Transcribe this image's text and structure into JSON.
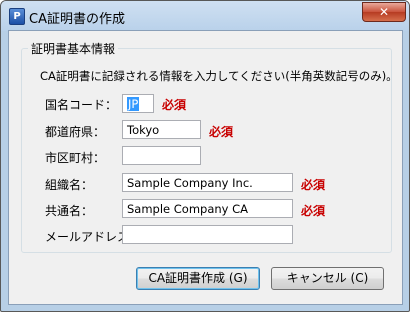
{
  "window": {
    "title": "CA証明書の作成",
    "icon": "app-icon",
    "close_label": "✕"
  },
  "group": {
    "title": "証明書基本情報",
    "description": "CA証明書に記録される情報を入力してください(半角英数記号のみ)。"
  },
  "fields": {
    "country": {
      "label": "国名コード：",
      "value": "JP",
      "required": "必須"
    },
    "state": {
      "label": "都道府県：",
      "value": "Tokyo",
      "required": "必須"
    },
    "city": {
      "label": "市区町村：",
      "value": ""
    },
    "organization": {
      "label": "組織名：",
      "value": "Sample Company Inc.",
      "required": "必須"
    },
    "common_name": {
      "label": "共通名：",
      "value": "Sample Company CA",
      "required": "必須"
    },
    "email": {
      "label": "メールアドレス：",
      "value": ""
    }
  },
  "buttons": {
    "create": "CA証明書作成 (G)",
    "cancel": "キャンセル (C)"
  }
}
